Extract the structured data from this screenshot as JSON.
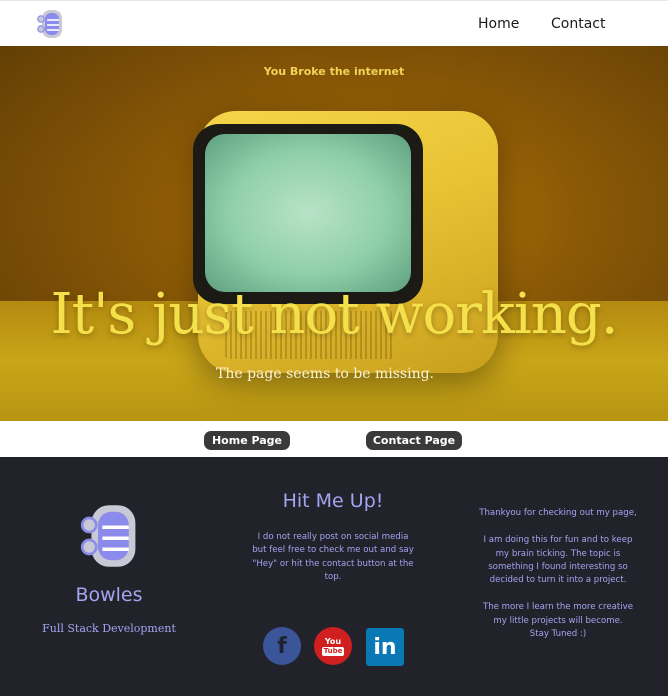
{
  "header": {
    "logo_icon": "database-stack-icon",
    "nav": {
      "home_label": "Home",
      "contact_label": "Contact"
    }
  },
  "hero": {
    "tagline": "You Broke the internet",
    "title": "It's just not working.",
    "subtitle": "The page seems to be missing.",
    "image_icon": "retro-tv-image"
  },
  "buttons": {
    "home_label": "Home Page",
    "contact_label": "Contact Page"
  },
  "footer": {
    "logo_icon": "database-stack-icon",
    "brand": "Bowles",
    "role": "Full Stack Development",
    "heading": "Hit Me Up!",
    "body": "I do not really post on social media but feel free to check me out and say \"Hey\" or hit the contact button at the top.",
    "thanks_lines": [
      "Thankyou for checking out my page,",
      "I am doing this for fun and to keep my brain ticking. The topic is something I found interesting so decided to turn it into a project.",
      "The more I learn the more creative my little projects will become."
    ],
    "stay_tuned": "Stay Tuned :)",
    "social": {
      "facebook_glyph": "f",
      "youtube_you": "You",
      "youtube_tube": "Tube",
      "linkedin_glyph": "in",
      "icons": [
        "facebook-icon",
        "youtube-icon",
        "linkedin-icon"
      ]
    }
  },
  "colors": {
    "accent": "#a3a4f2",
    "footer_bg": "#22232a",
    "pill_bg": "#3a3a3a",
    "hero_title": "#f4e04a"
  }
}
